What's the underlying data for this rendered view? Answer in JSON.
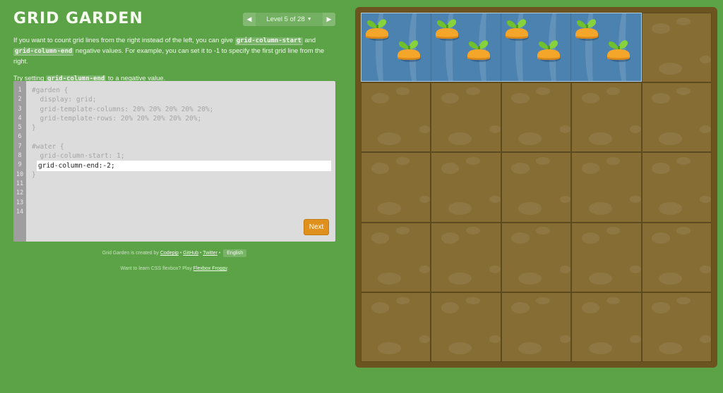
{
  "title": "GRID GARDEN",
  "level_nav": {
    "prev_icon": "left-triangle-icon",
    "label": "Level 5 of 28",
    "caret_icon": "caret-down-icon",
    "next_icon": "right-triangle-icon"
  },
  "instructions": {
    "p1": {
      "t1": "If you want to count grid lines from the right instead of the left, you can give ",
      "c1": "grid-column-start",
      "t2": " and ",
      "c2": "grid-column-end",
      "t3": " negative values. For example, you can set it to -1 to specify the first grid line from the right."
    },
    "p2": {
      "t1": "Try setting ",
      "c1": "grid-column-end",
      "t2": " to a negative value."
    }
  },
  "editor": {
    "line_numbers": [
      "1",
      "2",
      "3",
      "4",
      "5",
      "6",
      "7",
      "8",
      "9",
      "10",
      "11",
      "12",
      "13",
      "14"
    ],
    "code_lines": [
      "#garden {",
      "  display: grid;",
      "  grid-template-columns: 20% 20% 20% 20% 20%;",
      "  grid-template-rows: 20% 20% 20% 20% 20%;",
      "}",
      "",
      "#water {",
      "  grid-column-start: 1;",
      "",
      "}"
    ],
    "input_value": "grid-column-end:-2;",
    "next_label": "Next"
  },
  "credits": {
    "prefix": "Grid Garden is created by ",
    "link1": "Codepip",
    "sep": " • ",
    "link2": "GitHub",
    "link3": "Twitter",
    "language": "English"
  },
  "promo": {
    "prefix": "Want to learn CSS flexbox? Play ",
    "link": "Flexbox Froggy",
    "suffix": "."
  },
  "garden": {
    "columns": 5,
    "rows": 5,
    "water": {
      "column_start": 1,
      "column_end": -2,
      "row": 1
    },
    "carrots_per_water_cell": 2,
    "colors": {
      "background": "#5ba346",
      "soil": "#866d34",
      "border": "#6c5421",
      "water": "#4b82b0",
      "carrot": "#f4a62a",
      "leaf": "#7dc838",
      "next_button": "#e0901d"
    }
  }
}
